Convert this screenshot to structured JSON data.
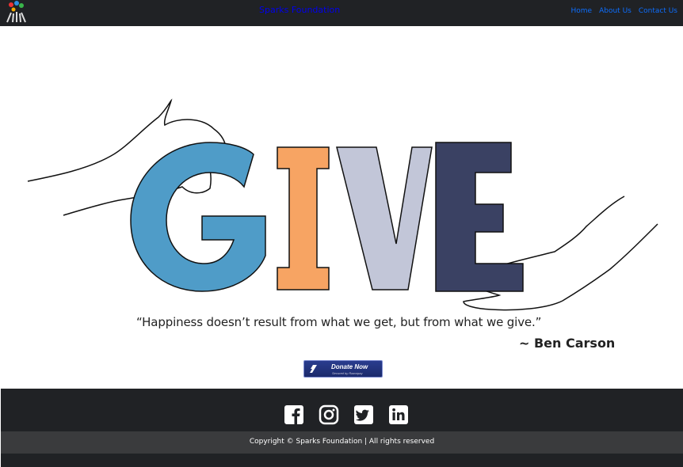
{
  "navbar": {
    "brand": "Sparks Foundation",
    "links": [
      "Home",
      "About Us",
      "Contact Us"
    ]
  },
  "hero": {
    "letters": [
      "G",
      "I",
      "V",
      "E"
    ],
    "colors": {
      "g": "#4f9cc8",
      "i": "#f7a463",
      "v": "#c2c6d8",
      "e": "#3a4163"
    }
  },
  "quote": {
    "text": "“Happiness doesn’t result from what we get, but from what we give.”",
    "author": "~ Ben Carson"
  },
  "donate": {
    "label": "Donate Now",
    "sub": "Secured by Razorpay"
  },
  "footer": {
    "social_icons": [
      "facebook-icon",
      "instagram-icon",
      "twitter-icon",
      "linkedin-icon"
    ],
    "copyright": "Copyright © Sparks Foundation | All rights reserved"
  }
}
